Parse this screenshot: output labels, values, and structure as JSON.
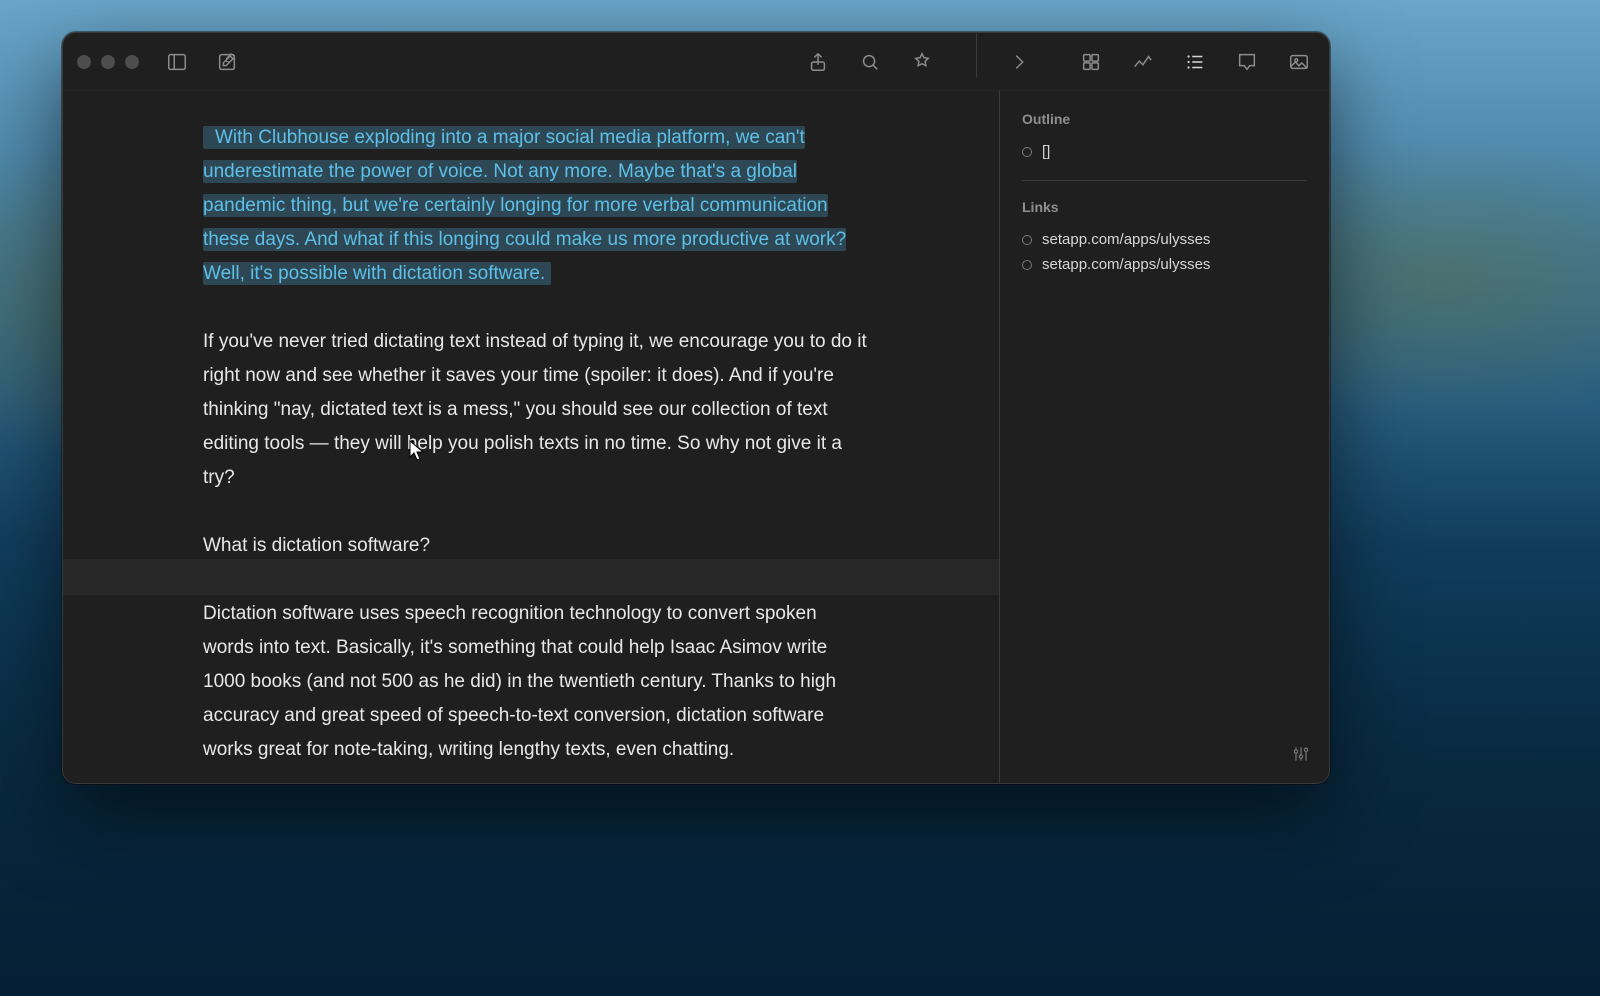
{
  "editor": {
    "selected_paragraph": "With Clubhouse exploding into a major social media platform, we can't underestimate the power of voice. Not any more. Maybe that's a global pandemic thing, but we're certainly longing for more verbal communication these days. And what if this longing could make us more productive at work? Well, it's possible with dictation software.",
    "paragraph_2": "If you've never tried dictating text instead of typing it, we encourage you to do it right now and see whether it saves your time (spoiler: it does). And if you're thinking \"nay, dictated text is a mess,\" you should see our collection of text editing tools — they will help you polish texts in no time. So why not give it a try?",
    "heading_2": "What is dictation software?",
    "paragraph_3": "Dictation software uses speech recognition technology to convert spoken words into text. Basically, it's something that could help Isaac Asimov write 1000 books (and not 500 as he did) in the twentieth century. Thanks to high accuracy and great speed of speech-to-text conversion, dictation software works great for note-taking, writing lengthy texts, even chatting."
  },
  "inspector": {
    "outline_title": "Outline",
    "outline_item": "[]",
    "links_title": "Links",
    "links": [
      "setapp.com/apps/ulysses",
      "setapp.com/apps/ulysses"
    ]
  }
}
